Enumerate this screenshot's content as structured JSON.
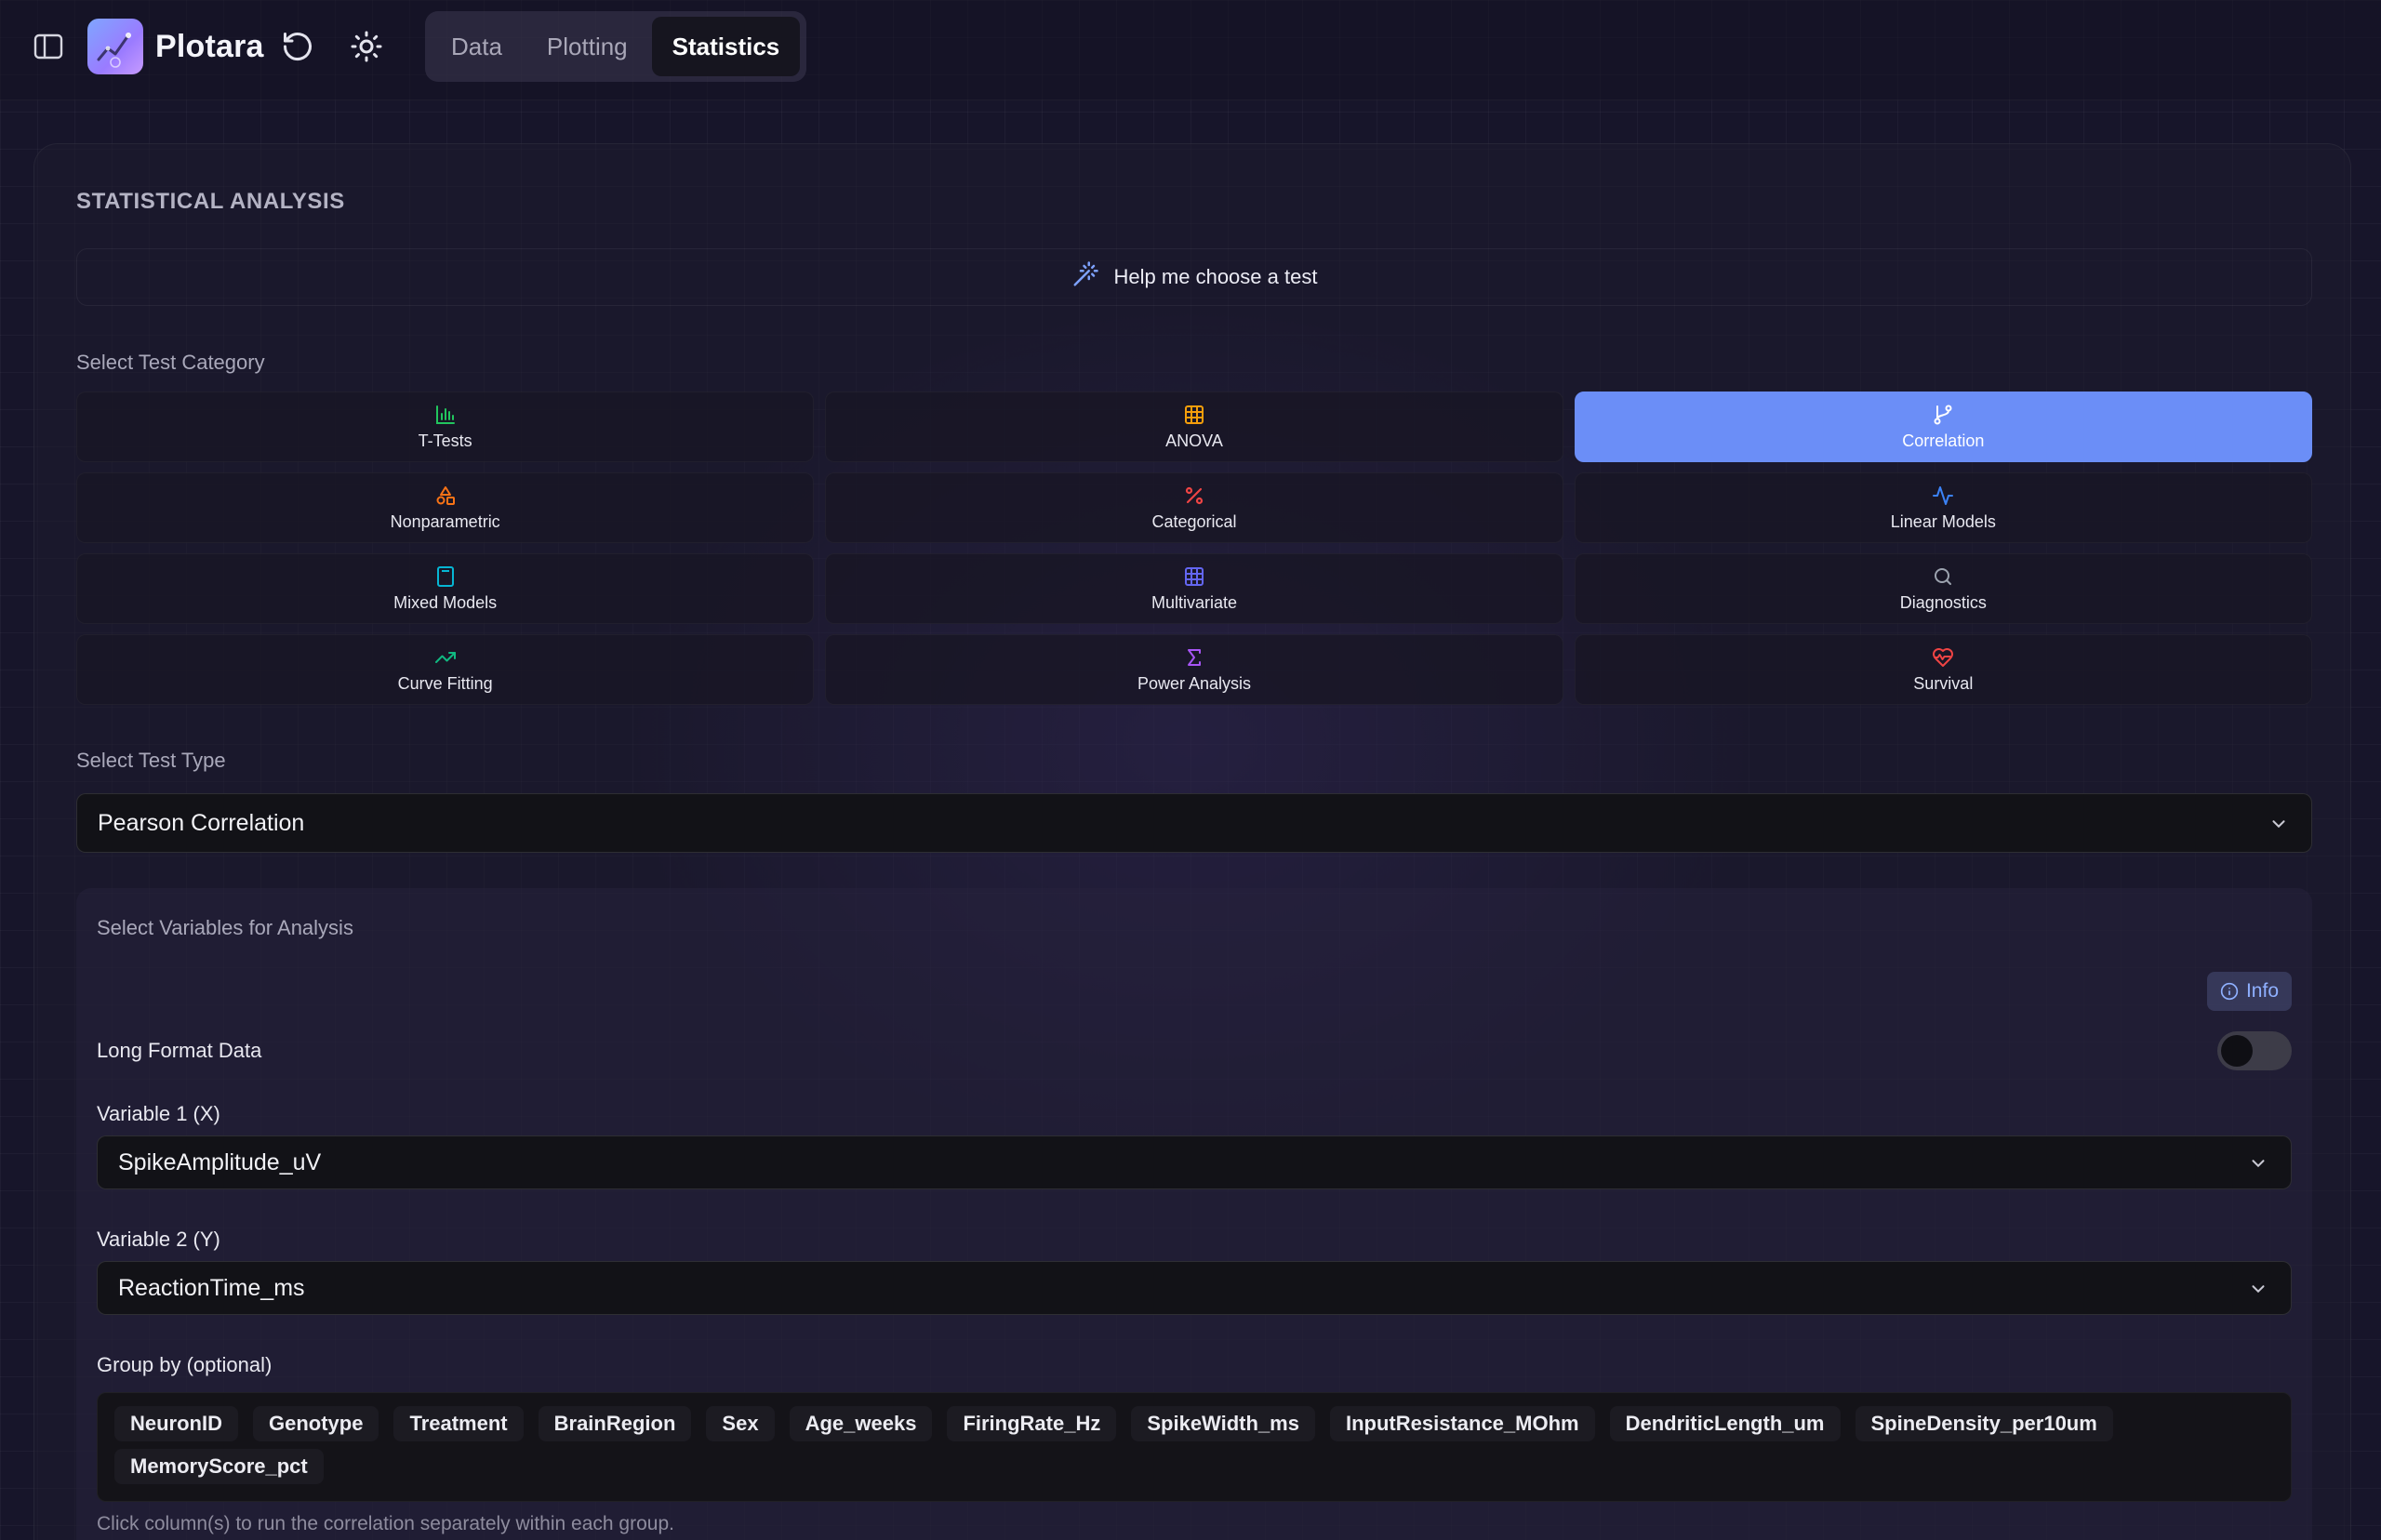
{
  "app": {
    "title": "Plotara"
  },
  "nav": {
    "tabs": [
      {
        "label": "Data"
      },
      {
        "label": "Plotting"
      },
      {
        "label": "Statistics"
      }
    ],
    "active": "Statistics"
  },
  "main": {
    "section_title": "STATISTICAL ANALYSIS",
    "help_label": "Help me choose a test",
    "category_label": "Select Test Category",
    "categories": [
      {
        "label": "T-Tests",
        "icon": "bar-chart-icon",
        "color": "#22c55e"
      },
      {
        "label": "ANOVA",
        "icon": "grid-icon",
        "color": "#f59e0b"
      },
      {
        "label": "Correlation",
        "icon": "git-branch-icon",
        "color": "#ffffff"
      },
      {
        "label": "Nonparametric",
        "icon": "shapes-icon",
        "color": "#f97316"
      },
      {
        "label": "Categorical",
        "icon": "percent-icon",
        "color": "#ef4444"
      },
      {
        "label": "Linear Models",
        "icon": "activity-icon",
        "color": "#3b82f6"
      },
      {
        "label": "Mixed Models",
        "icon": "calculator-icon",
        "color": "#06b6d4"
      },
      {
        "label": "Multivariate",
        "icon": "grid-3x3-icon",
        "color": "#6366f1"
      },
      {
        "label": "Diagnostics",
        "icon": "search-icon",
        "color": "#9ca3af"
      },
      {
        "label": "Curve Fitting",
        "icon": "trending-up-icon",
        "color": "#10b981"
      },
      {
        "label": "Power Analysis",
        "icon": "sigma-icon",
        "color": "#a855f7"
      },
      {
        "label": "Survival",
        "icon": "heart-pulse-icon",
        "color": "#ef4444"
      }
    ],
    "active_category": "Correlation",
    "test_type_label": "Select Test Type",
    "test_type_value": "Pearson Correlation"
  },
  "variables": {
    "title": "Select Variables for Analysis",
    "info_label": "Info",
    "long_format_label": "Long Format Data",
    "long_format_on": false,
    "var1_label": "Variable 1 (X)",
    "var1_value": "SpikeAmplitude_uV",
    "var2_label": "Variable 2 (Y)",
    "var2_value": "ReactionTime_ms",
    "group_label": "Group by (optional)",
    "group_columns": [
      "NeuronID",
      "Genotype",
      "Treatment",
      "BrainRegion",
      "Sex",
      "Age_weeks",
      "FiringRate_Hz",
      "SpikeWidth_ms",
      "InputResistance_MOhm",
      "DendriticLength_um",
      "SpineDensity_per10um",
      "MemoryScore_pct"
    ],
    "group_hint": "Click column(s) to run the correlation separately within each group."
  },
  "colors": {
    "accent": "#6b8ef7",
    "background": "#17152a",
    "info_text": "#8fb0ff"
  }
}
